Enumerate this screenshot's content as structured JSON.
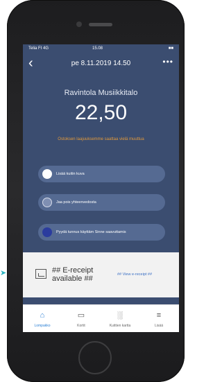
{
  "status_bar": {
    "carrier": "Telia FI 4G",
    "time": "15.08",
    "battery": "■■"
  },
  "nav": {
    "back_icon": "‹",
    "title": "pe 8.11.2019 14.50",
    "more_icon": "•••"
  },
  "receipt_header": {
    "venue": "Ravintola Musiikkitalo",
    "amount": "22,50",
    "warning": "Ostoksen laajuuksemme saattaa vielä muuttua"
  },
  "actions": [
    {
      "label": "Lisää kuitin kuva",
      "icon": "camera-icon"
    },
    {
      "label": "Jaa pois yhteenvedosta",
      "icon": "share-icon"
    },
    {
      "label": "Pyydä tunnus käyttäm Sinne saavuttamis",
      "icon": "search-icon"
    }
  ],
  "ereceipt": {
    "label_line1": "## E-receipt",
    "label_line2": "available ##",
    "link": "## View e-receipt ##"
  },
  "tabs": [
    {
      "label": "Lompakko",
      "icon_glyph": "⌂",
      "icon": "home-icon",
      "active": true
    },
    {
      "label": "Kortit",
      "icon_glyph": "▭",
      "icon": "cards-icon",
      "active": false
    },
    {
      "label": "Kuittien kartta",
      "icon_glyph": "░",
      "icon": "chart-icon",
      "active": false
    },
    {
      "label": "Lisää",
      "icon_glyph": "≡",
      "icon": "menu-icon",
      "active": false
    }
  ],
  "colors": {
    "screen_bg": "#3b4d70",
    "pill_bg": "#556a92",
    "warning": "#e39a3b",
    "link": "#3a6fc4",
    "active_tab": "#2a7fd4"
  }
}
